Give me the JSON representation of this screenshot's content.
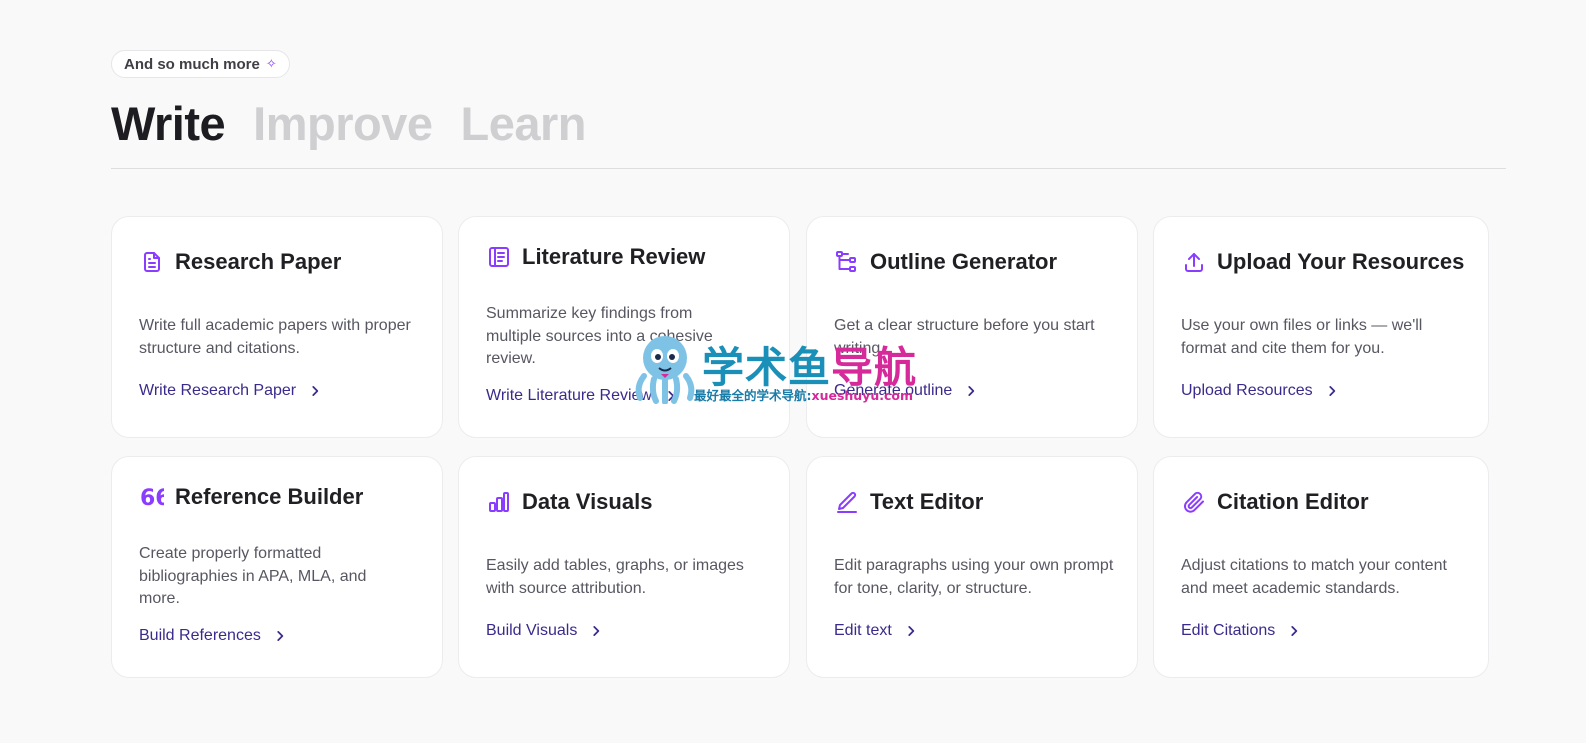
{
  "badge": {
    "label": "And so much more",
    "icon": "sparkle-icon"
  },
  "tabs": [
    {
      "label": "Write",
      "active": true
    },
    {
      "label": "Improve",
      "active": false
    },
    {
      "label": "Learn",
      "active": false
    }
  ],
  "accent_color": "#8b3dff",
  "link_color": "#3b2a8c",
  "cards": [
    {
      "title": "Research Paper",
      "icon": "document-icon",
      "description": "Write full academic papers with proper structure and citations.",
      "link": "Write Research Paper"
    },
    {
      "title": "Literature Review",
      "icon": "book-icon",
      "description": "Summarize key findings from multiple sources into a cohesive review.",
      "link": "Write Literature Review"
    },
    {
      "title": "Outline Generator",
      "icon": "outline-tree-icon",
      "description": "Get a clear structure before you start writing.",
      "link": "Generate outline"
    },
    {
      "title": "Upload Your Resources",
      "icon": "upload-icon",
      "description": "Use your own files or links — we'll format and cite them for you.",
      "link": "Upload Resources"
    },
    {
      "title": "Reference Builder",
      "icon": "quote-icon",
      "description": "Create properly formatted bibliographies in APA, MLA, and more.",
      "link": "Build References"
    },
    {
      "title": "Data Visuals",
      "icon": "bar-chart-icon",
      "description": "Easily add tables, graphs, or images with source attribution.",
      "link": "Build Visuals"
    },
    {
      "title": "Text Editor",
      "icon": "pen-icon",
      "description": "Edit paragraphs using your own prompt for tone, clarity, or structure.",
      "link": "Edit text"
    },
    {
      "title": "Citation Editor",
      "icon": "paperclip-icon",
      "description": "Adjust citations to match your content and meet academic standards.",
      "link": "Edit Citations"
    }
  ],
  "watermark": {
    "title_part1": "学术鱼",
    "title_part2": "导航",
    "subtitle_part1": "最好最全的学术导航:",
    "subtitle_part2": "xueshuyu.com"
  }
}
